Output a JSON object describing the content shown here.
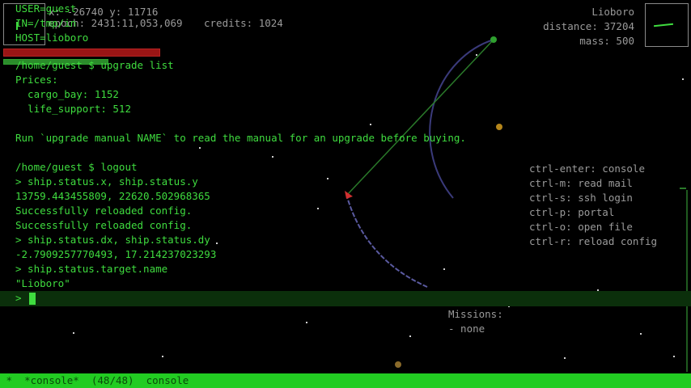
{
  "hud": {
    "position": "x: -26740 y: 11716",
    "epoch": "epoch: 2431:11,053,069",
    "credits": "credits: 1024",
    "target_name": "Lioboro",
    "target_distance": "distance: 37204",
    "target_mass": "mass: 500"
  },
  "ssh_info": {
    "user": "USER=guest",
    "in": "IN=/tmp/in",
    "host": "HOST=lioboro"
  },
  "console": {
    "lines": [
      "/home/guest $ upgrade list",
      "Prices:",
      "  cargo_bay: 1152",
      "  life_support: 512",
      "",
      "Run `upgrade manual NAME` to read the manual for an upgrade before buying.",
      "",
      "/home/guest $ logout",
      "> ship.status.x, ship.status.y",
      "13759.443455809, 22620.502968365",
      "Successfully reloaded config.",
      "Successfully reloaded config.",
      "> ship.status.dx, ship.status.dy",
      "-2.7909257770493, 17.214237023293",
      "> ship.status.target.name",
      "\"Lioboro\""
    ],
    "prompt": ">"
  },
  "shortcuts": [
    "ctrl-enter: console",
    "ctrl-m: read mail",
    "ctrl-s: ssh login",
    "ctrl-p: portal",
    "ctrl-o: open file",
    "ctrl-r: reload config"
  ],
  "missions": {
    "title": "Missions:",
    "items": [
      "- none"
    ]
  },
  "modeline": {
    "text": " *  *console*  (48/48)  console"
  },
  "colors": {
    "terminal_green": "#3fdc3f",
    "hud_gray": "#9a9a9a",
    "modeline_bg": "#22cc22",
    "hull_red": "#9a1515"
  },
  "gauges": {
    "hull_fraction": 1.0,
    "fuel_fraction": 1.0
  }
}
